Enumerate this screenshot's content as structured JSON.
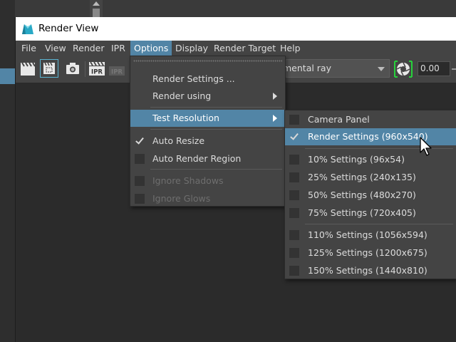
{
  "window": {
    "title": "Render View"
  },
  "menubar": {
    "items": [
      "File",
      "View",
      "Render",
      "IPR",
      "Options",
      "Display",
      "Render Target",
      "Help"
    ],
    "active": "Options"
  },
  "toolbar": {
    "renderer_value": "mental ray",
    "exposure_value": "0.00",
    "icons": [
      "clapper-icon",
      "clapper-region-icon",
      "camera-snapshot-icon",
      "ipr-icon",
      "ipr-disabled-icon",
      "exposure-lens-icon"
    ]
  },
  "options_menu": {
    "items": [
      {
        "label": "Render Settings ...",
        "checked": false,
        "submenu": false,
        "enabled": true
      },
      {
        "label": "Render using",
        "checked": false,
        "submenu": true,
        "enabled": true
      },
      {
        "label": "Test Resolution",
        "checked": false,
        "submenu": true,
        "enabled": true,
        "highlighted": true
      },
      {
        "label": "Auto Resize",
        "checked": true,
        "submenu": false,
        "enabled": true
      },
      {
        "label": "Auto Render Region",
        "checked": false,
        "submenu": false,
        "enabled": true
      },
      {
        "label": "Ignore Shadows",
        "checked": false,
        "submenu": false,
        "enabled": false
      },
      {
        "label": "Ignore Glows",
        "checked": false,
        "submenu": false,
        "enabled": false
      }
    ]
  },
  "test_resolution_menu": {
    "items": [
      {
        "label": "Camera Panel",
        "checked": false
      },
      {
        "label": "Render Settings (960x540)",
        "checked": true,
        "highlighted": true
      },
      {
        "label": "10% Settings (96x54)",
        "checked": false
      },
      {
        "label": "25% Settings (240x135)",
        "checked": false
      },
      {
        "label": "50% Settings (480x270)",
        "checked": false
      },
      {
        "label": "75% Settings (720x405)",
        "checked": false
      },
      {
        "label": "110% Settings (1056x594)",
        "checked": false
      },
      {
        "label": "125% Settings (1200x675)",
        "checked": false
      },
      {
        "label": "150% Settings (1440x810)",
        "checked": false
      }
    ]
  },
  "colors": {
    "highlight": "#5285a6",
    "menu_bg": "#444444",
    "viewport_bg": "#2b2b2b"
  }
}
